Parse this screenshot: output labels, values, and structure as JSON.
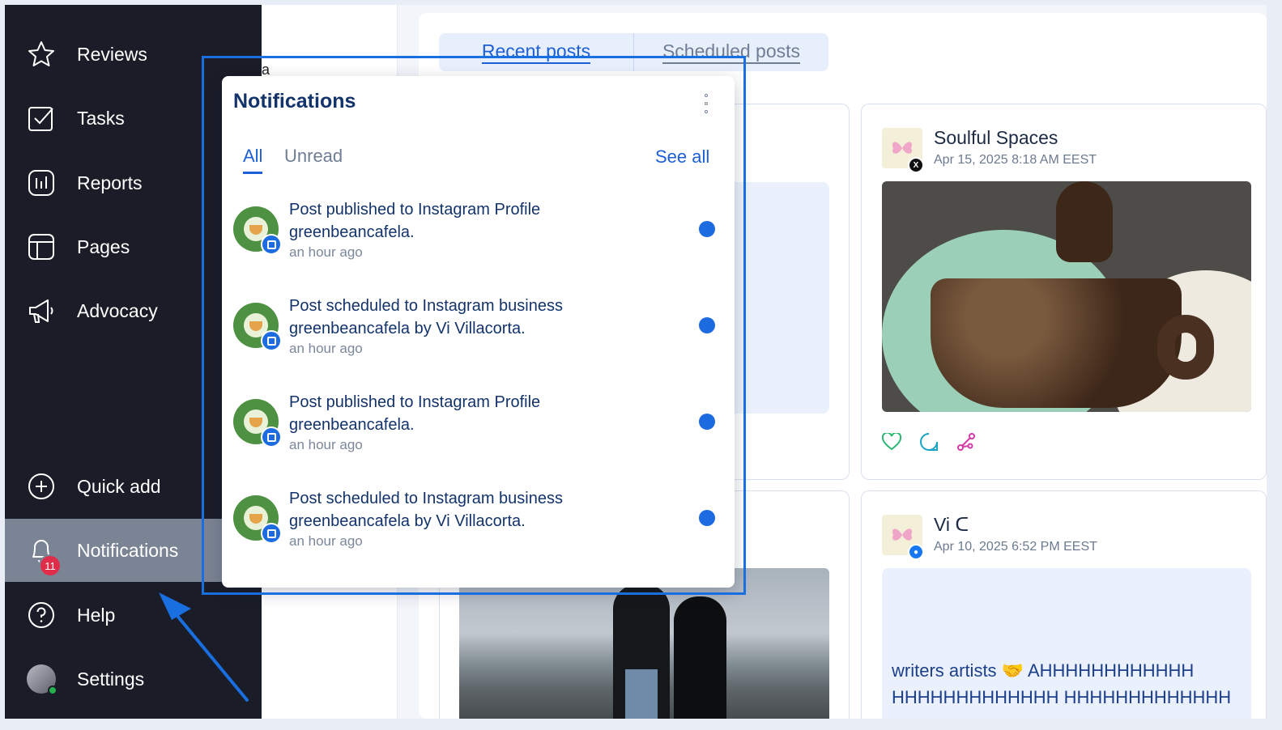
{
  "sidebar": {
    "items": [
      {
        "label": "Reviews",
        "icon": "star-icon"
      },
      {
        "label": "Tasks",
        "icon": "checkbox-icon"
      },
      {
        "label": "Reports",
        "icon": "bar-chart-icon"
      },
      {
        "label": "Pages",
        "icon": "layout-icon"
      },
      {
        "label": "Advocacy",
        "icon": "megaphone-icon"
      }
    ],
    "bottom_items": [
      {
        "label": "Quick add",
        "icon": "plus-circle-icon"
      },
      {
        "label": "Notifications",
        "icon": "bell-icon",
        "badge": "11",
        "active": true
      },
      {
        "label": "Help",
        "icon": "help-circle-icon"
      },
      {
        "label": "Settings",
        "icon": "avatar"
      }
    ]
  },
  "main": {
    "stub_text": "ta",
    "tabs": [
      "Recent posts",
      "Scheduled posts"
    ],
    "posts": [
      {
        "account": "Soulful Spaces",
        "date": "Apr 15, 2025 8:18 AM EEST",
        "network": "x"
      },
      {
        "account": "Vi ᑕ",
        "date": "Apr 10, 2025 6:52 PM EEST",
        "network": "bluesky",
        "text_line1": "writers artists 🤝 AHHHHHHHHHHHH",
        "text_line2": "HHHHHHHHHHHHH HHHHHHHHHHHHH"
      }
    ]
  },
  "notifications": {
    "title": "Notifications",
    "tabs": {
      "all": "All",
      "unread": "Unread"
    },
    "see_all": "See all",
    "items": [
      {
        "line1": "Post published to Instagram Profile",
        "line2": "greenbeancafela.",
        "time": "an hour ago",
        "unread": true
      },
      {
        "line1": "Post scheduled to Instagram business",
        "line2": "greenbeancafela by Vi Villacorta.",
        "time": "an hour ago",
        "unread": true
      },
      {
        "line1": "Post published to Instagram Profile",
        "line2": "greenbeancafela.",
        "time": "an hour ago",
        "unread": true
      },
      {
        "line1": "Post scheduled to Instagram business",
        "line2": "greenbeancafela by Vi Villacorta.",
        "time": "an hour ago",
        "unread": true
      }
    ]
  },
  "colors": {
    "sidebar_bg": "#1a1c27",
    "active_item_bg": "#7b8494",
    "accent": "#1d5fd6",
    "badge": "#e02e4a",
    "annotation": "#1a6fe0"
  }
}
